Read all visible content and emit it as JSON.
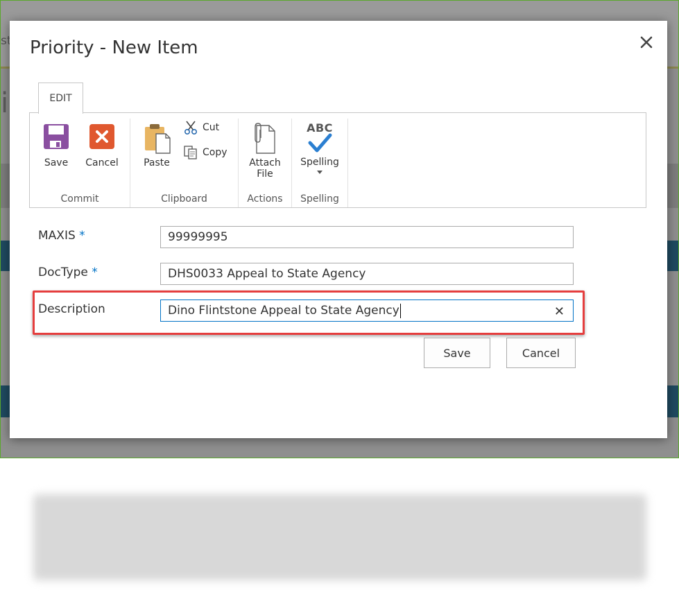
{
  "background": {
    "partial_text": "st",
    "partial_glyph": "i"
  },
  "dialog": {
    "title": "Priority - New Item"
  },
  "ribbon": {
    "tab_label": "EDIT",
    "groups": {
      "commit": {
        "label": "Commit",
        "save_label": "Save",
        "cancel_label": "Cancel"
      },
      "clipboard": {
        "label": "Clipboard",
        "paste_label": "Paste",
        "cut_label": "Cut",
        "copy_label": "Copy"
      },
      "actions": {
        "label": "Actions",
        "attach_label_line1": "Attach",
        "attach_label_line2": "File"
      },
      "spelling": {
        "label": "Spelling",
        "spelling_label": "Spelling",
        "abc_text": "ABC"
      }
    }
  },
  "form": {
    "maxis": {
      "label": "MAXIS",
      "required_mark": "*",
      "value": "99999995"
    },
    "doctype": {
      "label": "DocType",
      "required_mark": "*",
      "value": "DHS0033 Appeal to State Agency"
    },
    "description": {
      "label": "Description",
      "value": "Dino Flintstone Appeal to State Agency",
      "clear_symbol": "✕"
    },
    "save_label": "Save",
    "cancel_label": "Cancel"
  },
  "colors": {
    "save_icon": "#8a4fa0",
    "cancel_icon": "#e0582f",
    "highlight_border": "#e53e3e",
    "required_mark": "#0072c6",
    "spelling_check": "#2b7fd1"
  }
}
